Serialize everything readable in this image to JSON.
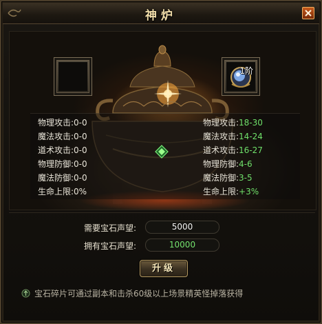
{
  "window": {
    "title": "神炉",
    "close_icon": "close-icon"
  },
  "furnace": {
    "target_gem_level": "1阶",
    "left_stats": [
      {
        "label": "物理攻击:",
        "value": "0-0"
      },
      {
        "label": "魔法攻击:",
        "value": "0-0"
      },
      {
        "label": "道术攻击:",
        "value": "0-0"
      },
      {
        "label": "物理防御:",
        "value": "0-0"
      },
      {
        "label": "魔法防御:",
        "value": "0-0"
      },
      {
        "label": "生命上限:",
        "value": "0%"
      }
    ],
    "right_stats": [
      {
        "label": "物理攻击:",
        "value": "18-30"
      },
      {
        "label": "魔法攻击:",
        "value": "14-24"
      },
      {
        "label": "道术攻击:",
        "value": "16-27"
      },
      {
        "label": "物理防御:",
        "value": "4-6"
      },
      {
        "label": "魔法防御:",
        "value": "3-5"
      },
      {
        "label": "生命上限:",
        "value": "+3%"
      }
    ],
    "stat_value_color_upgraded": "#6fe06a"
  },
  "requirements": {
    "required_label": "需要宝石声望:",
    "required_value": "5000",
    "owned_label": "拥有宝石声望:",
    "owned_value": "10000"
  },
  "upgrade_button_label": "升级",
  "hint_text": "宝石碎片可通过副本和击杀60级以上场景精英怪掉落获得"
}
